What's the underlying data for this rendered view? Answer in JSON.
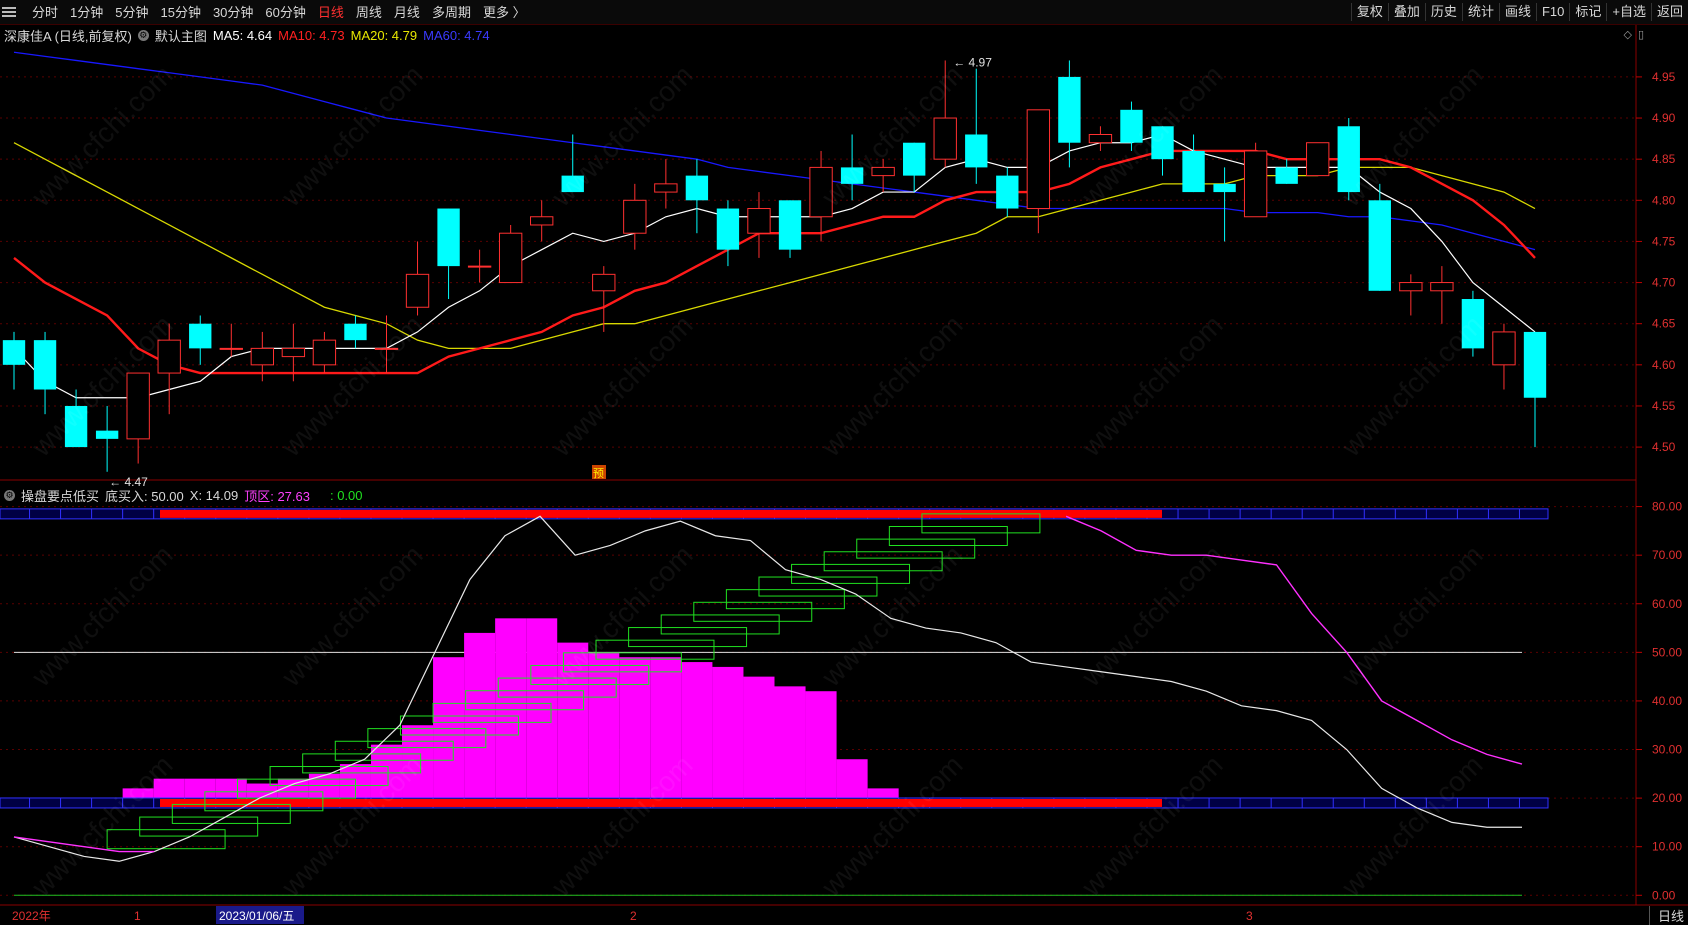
{
  "toolbar": {
    "periods": [
      "分时",
      "1分钟",
      "5分钟",
      "15分钟",
      "30分钟",
      "60分钟",
      "日线",
      "周线",
      "月线",
      "多周期",
      "更多 〉"
    ],
    "active_period": "日线",
    "buttons": [
      "复权",
      "叠加",
      "历史",
      "统计",
      "画线",
      "F10",
      "标记",
      "+自选",
      "返回"
    ]
  },
  "main_legend": {
    "stock": "深康佳A (日线,前复权)",
    "template": "默认主图",
    "ma5": "MA5: 4.64",
    "ma10": "MA10: 4.73",
    "ma20": "MA20: 4.79",
    "ma60": "MA60: 4.74",
    "colors": {
      "ma5": "#ffffff",
      "ma10": "#ff2020",
      "ma20": "#e8e800",
      "ma60": "#2020ff"
    }
  },
  "sub_legend": {
    "name": "操盘要点低买",
    "buy": "底买入: 50.00",
    "x": "X: 14.09",
    "top_zone": "顶区: 27.63",
    "extra": ": 0.00"
  },
  "price_axis": [
    "4.95",
    "4.90",
    "4.85",
    "4.80",
    "4.75",
    "4.70",
    "4.65",
    "4.60",
    "4.55",
    "4.50"
  ],
  "osc_axis": [
    "80.00",
    "70.00",
    "60.00",
    "50.00",
    "40.00",
    "30.00",
    "20.00",
    "10.00",
    "0.00"
  ],
  "annotations": {
    "high": "4.97",
    "low": "4.47",
    "marker": "预"
  },
  "date_axis": {
    "year": "2022年",
    "m1": "1",
    "cursor_date": "2023/01/06/五",
    "m2": "2",
    "m3": "3"
  },
  "bottom_button": "日线",
  "watermark": "www.cfchi.com",
  "chart_data": {
    "type": "candlestick",
    "price_range": [
      4.46,
      4.99
    ],
    "candles": [
      [
        4.63,
        4.6,
        4.64,
        4.57
      ],
      [
        4.63,
        4.57,
        4.64,
        4.54
      ],
      [
        4.55,
        4.5,
        4.57,
        4.5
      ],
      [
        4.52,
        4.51,
        4.55,
        4.47
      ],
      [
        4.51,
        4.59,
        4.59,
        4.48
      ],
      [
        4.59,
        4.63,
        4.65,
        4.54
      ],
      [
        4.65,
        4.62,
        4.66,
        4.6
      ],
      [
        4.62,
        4.62,
        4.65,
        4.61
      ],
      [
        4.6,
        4.62,
        4.64,
        4.58
      ],
      [
        4.61,
        4.62,
        4.65,
        4.58
      ],
      [
        4.6,
        4.63,
        4.64,
        4.59
      ],
      [
        4.65,
        4.63,
        4.66,
        4.62
      ],
      [
        4.62,
        4.62,
        4.66,
        4.59
      ],
      [
        4.67,
        4.71,
        4.75,
        4.66
      ],
      [
        4.79,
        4.72,
        4.79,
        4.68
      ],
      [
        4.72,
        4.72,
        4.74,
        4.7
      ],
      [
        4.7,
        4.76,
        4.77,
        4.7
      ],
      [
        4.77,
        4.78,
        4.8,
        4.75
      ],
      [
        4.83,
        4.81,
        4.88,
        4.81
      ],
      [
        4.69,
        4.71,
        4.72,
        4.64
      ],
      [
        4.76,
        4.8,
        4.82,
        4.74
      ],
      [
        4.81,
        4.82,
        4.85,
        4.79
      ],
      [
        4.83,
        4.8,
        4.85,
        4.76
      ],
      [
        4.79,
        4.74,
        4.8,
        4.72
      ],
      [
        4.76,
        4.79,
        4.81,
        4.73
      ],
      [
        4.8,
        4.74,
        4.8,
        4.73
      ],
      [
        4.78,
        4.84,
        4.86,
        4.75
      ],
      [
        4.84,
        4.82,
        4.88,
        4.8
      ],
      [
        4.83,
        4.84,
        4.85,
        4.81
      ],
      [
        4.87,
        4.83,
        4.87,
        4.81
      ],
      [
        4.85,
        4.9,
        4.97,
        4.84
      ],
      [
        4.88,
        4.84,
        4.96,
        4.82
      ],
      [
        4.83,
        4.79,
        4.84,
        4.78
      ],
      [
        4.79,
        4.91,
        4.91,
        4.76
      ],
      [
        4.95,
        4.87,
        4.97,
        4.84
      ],
      [
        4.87,
        4.88,
        4.89,
        4.86
      ],
      [
        4.91,
        4.87,
        4.92,
        4.86
      ],
      [
        4.89,
        4.85,
        4.89,
        4.83
      ],
      [
        4.86,
        4.81,
        4.88,
        4.81
      ],
      [
        4.82,
        4.81,
        4.84,
        4.75
      ],
      [
        4.78,
        4.86,
        4.87,
        4.78
      ],
      [
        4.84,
        4.82,
        4.85,
        4.82
      ],
      [
        4.83,
        4.87,
        4.87,
        4.83
      ],
      [
        4.89,
        4.81,
        4.9,
        4.8
      ],
      [
        4.8,
        4.69,
        4.82,
        4.69
      ],
      [
        4.69,
        4.7,
        4.71,
        4.66
      ],
      [
        4.69,
        4.7,
        4.72,
        4.65
      ],
      [
        4.68,
        4.62,
        4.69,
        4.61
      ],
      [
        4.6,
        4.64,
        4.65,
        4.57
      ],
      [
        4.64,
        4.56,
        4.64,
        4.5
      ]
    ],
    "ma5": [
      4.62,
      4.58,
      4.56,
      4.56,
      4.56,
      4.57,
      4.58,
      4.61,
      4.62,
      4.62,
      4.62,
      4.62,
      4.62,
      4.64,
      4.67,
      4.69,
      4.72,
      4.74,
      4.76,
      4.75,
      4.76,
      4.78,
      4.79,
      4.78,
      4.78,
      4.78,
      4.78,
      4.79,
      4.81,
      4.81,
      4.84,
      4.85,
      4.84,
      4.84,
      4.86,
      4.87,
      4.87,
      4.88,
      4.86,
      4.85,
      4.84,
      4.84,
      4.84,
      4.84,
      4.81,
      4.79,
      4.75,
      4.7,
      4.67,
      4.64
    ],
    "ma10": [
      4.73,
      4.7,
      4.68,
      4.66,
      4.62,
      4.6,
      4.59,
      4.59,
      4.59,
      4.59,
      4.59,
      4.59,
      4.59,
      4.59,
      4.61,
      4.62,
      4.63,
      4.64,
      4.66,
      4.67,
      4.69,
      4.7,
      4.72,
      4.74,
      4.76,
      4.76,
      4.76,
      4.77,
      4.78,
      4.78,
      4.8,
      4.81,
      4.81,
      4.81,
      4.82,
      4.84,
      4.85,
      4.86,
      4.86,
      4.86,
      4.86,
      4.85,
      4.85,
      4.85,
      4.85,
      4.84,
      4.82,
      4.8,
      4.77,
      4.73
    ],
    "ma20": [
      4.87,
      4.85,
      4.83,
      4.81,
      4.79,
      4.77,
      4.75,
      4.73,
      4.71,
      4.69,
      4.67,
      4.66,
      4.65,
      4.63,
      4.62,
      4.62,
      4.62,
      4.63,
      4.64,
      4.65,
      4.65,
      4.66,
      4.67,
      4.68,
      4.69,
      4.7,
      4.71,
      4.72,
      4.73,
      4.74,
      4.75,
      4.76,
      4.78,
      4.78,
      4.79,
      4.8,
      4.81,
      4.82,
      4.82,
      4.82,
      4.83,
      4.83,
      4.83,
      4.84,
      4.84,
      4.84,
      4.83,
      4.82,
      4.81,
      4.79
    ],
    "ma60": [
      4.98,
      4.975,
      4.97,
      4.965,
      4.96,
      4.955,
      4.95,
      4.945,
      4.94,
      4.93,
      4.92,
      4.91,
      4.9,
      4.895,
      4.89,
      4.885,
      4.88,
      4.875,
      4.87,
      4.865,
      4.86,
      4.855,
      4.85,
      4.84,
      4.835,
      4.83,
      4.825,
      4.82,
      4.815,
      4.81,
      4.805,
      4.8,
      4.795,
      4.79,
      4.79,
      4.79,
      4.79,
      4.79,
      4.79,
      4.79,
      4.785,
      4.785,
      4.785,
      4.78,
      4.78,
      4.775,
      4.77,
      4.76,
      4.75,
      4.74
    ],
    "osc": {
      "range": [
        -2,
        83
      ],
      "white": [
        12,
        10,
        8,
        7,
        9,
        12,
        16,
        20,
        23,
        25,
        28,
        35,
        50,
        65,
        74,
        78,
        70,
        72,
        75,
        77,
        74,
        73,
        67,
        65,
        62,
        57,
        55,
        54,
        52,
        48,
        47,
        46,
        45,
        44,
        42,
        39,
        38,
        36,
        30,
        22,
        18,
        15,
        14,
        14
      ],
      "magenta_idx_from": 30,
      "magenta": [
        78,
        75,
        71,
        70,
        70,
        69,
        68,
        58,
        50,
        40,
        36,
        32,
        29,
        27
      ],
      "hist": [
        20,
        22,
        24,
        24,
        24,
        23,
        24,
        25,
        27,
        31,
        35,
        49,
        54,
        57,
        57,
        52,
        50,
        49,
        49,
        48,
        47,
        45,
        43,
        42,
        28,
        22
      ]
    }
  }
}
